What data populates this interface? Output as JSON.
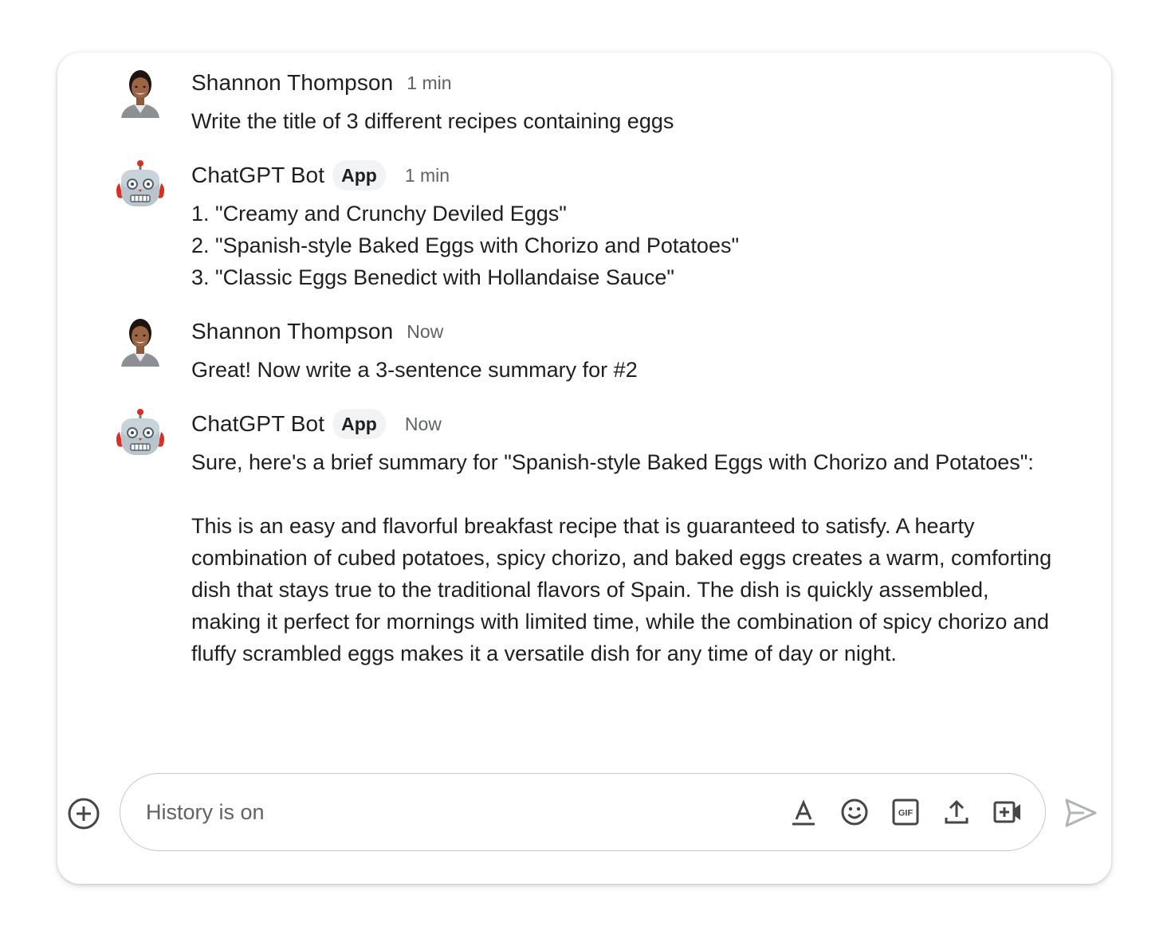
{
  "messages": [
    {
      "sender": "Shannon Thompson",
      "time": "1 min",
      "lines": [
        "Write the title of 3 different recipes containing eggs"
      ]
    },
    {
      "sender": "ChatGPT Bot",
      "badge": "App",
      "time": "1 min",
      "lines": [
        "1. \"Creamy and Crunchy Deviled Eggs\"",
        "2. \"Spanish-style Baked Eggs with Chorizo and Potatoes\"",
        "3. \"Classic Eggs Benedict with Hollandaise Sauce\""
      ]
    },
    {
      "sender": "Shannon Thompson",
      "time": "Now",
      "lines": [
        "Great!  Now write a 3-sentence summary for #2"
      ]
    },
    {
      "sender": "ChatGPT Bot",
      "badge": "App",
      "time": "Now",
      "intro": "Sure, here's a brief summary for \"Spanish-style Baked Eggs with Chorizo and Potatoes\":",
      "summary": "This is an easy and flavorful breakfast recipe that is guaranteed to satisfy. A hearty combination of cubed potatoes, spicy chorizo, and baked eggs creates a warm, comforting dish that stays true to the traditional flavors of Spain. The dish is quickly assembled, making it perfect for mornings with limited time, while the combination of spicy chorizo and fluffy scrambled eggs makes it a versatile dish for any time of day or night."
    }
  ],
  "composer": {
    "placeholder": "History is on",
    "add_icon": "add-circle-icon",
    "tools": [
      "text-format-icon",
      "emoji-icon",
      "gif-icon",
      "upload-icon",
      "video-meeting-icon"
    ],
    "send_icon": "send-icon"
  },
  "colors": {
    "text": "#1f1f1f",
    "secondary": "#5f6368",
    "badge_bg": "#f1f3f4",
    "border": "#c4c7c5",
    "robot_red": "#d93025"
  }
}
